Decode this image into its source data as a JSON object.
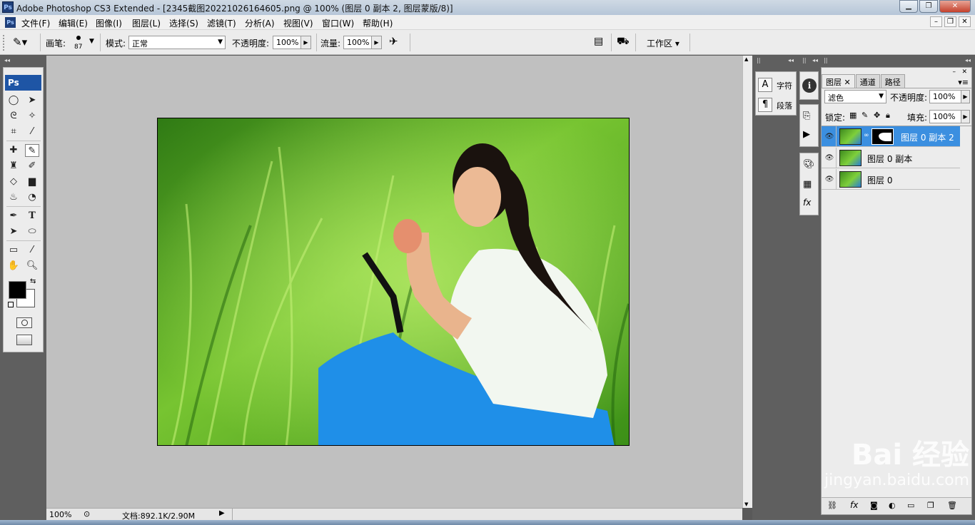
{
  "window": {
    "title": "Adobe Photoshop CS3 Extended - [2345截图20221026164605.png @ 100% (图层 0 副本 2, 图层蒙版/8)]",
    "app_icon": "Ps",
    "minimize_icon": "minimize-icon",
    "maximize_icon": "maximize-icon",
    "close_icon": "close-icon"
  },
  "menu": {
    "items": [
      "文件(F)",
      "编辑(E)",
      "图像(I)",
      "图层(L)",
      "选择(S)",
      "滤镜(T)",
      "分析(A)",
      "视图(V)",
      "窗口(W)",
      "帮助(H)"
    ]
  },
  "options": {
    "brush_label": "画笔:",
    "brush_size": "87",
    "mode_label": "模式:",
    "mode_value": "正常",
    "opacity_label": "不透明度:",
    "opacity_value": "100%",
    "flow_label": "流量:",
    "flow_value": "100%",
    "workspace_label": "工作区 ▾"
  },
  "toolbox": {
    "logo": "Ps"
  },
  "char_panel": {
    "char_label": "字符",
    "para_label": "段落"
  },
  "layers_panel": {
    "tabs": [
      "图层",
      "通道",
      "路径"
    ],
    "blend_mode": "滤色",
    "opacity_label": "不透明度:",
    "opacity_value": "100%",
    "lock_label": "锁定:",
    "fill_label": "填充:",
    "fill_value": "100%",
    "layers": [
      {
        "name": "图层 0 副本 2",
        "selected": true,
        "has_mask": true
      },
      {
        "name": "图层 0 副本",
        "selected": false,
        "has_mask": false
      },
      {
        "name": "图层 0",
        "selected": false,
        "has_mask": false
      }
    ]
  },
  "status": {
    "zoom": "100%",
    "doc_info": "文档:892.1K/2.90M"
  },
  "watermark": {
    "line1": "Bai 经验",
    "line2": "jingyan.baidu.com"
  },
  "colors": {
    "selection": "#3b8fe0",
    "foreground": "#000000",
    "background": "#ffffff"
  }
}
